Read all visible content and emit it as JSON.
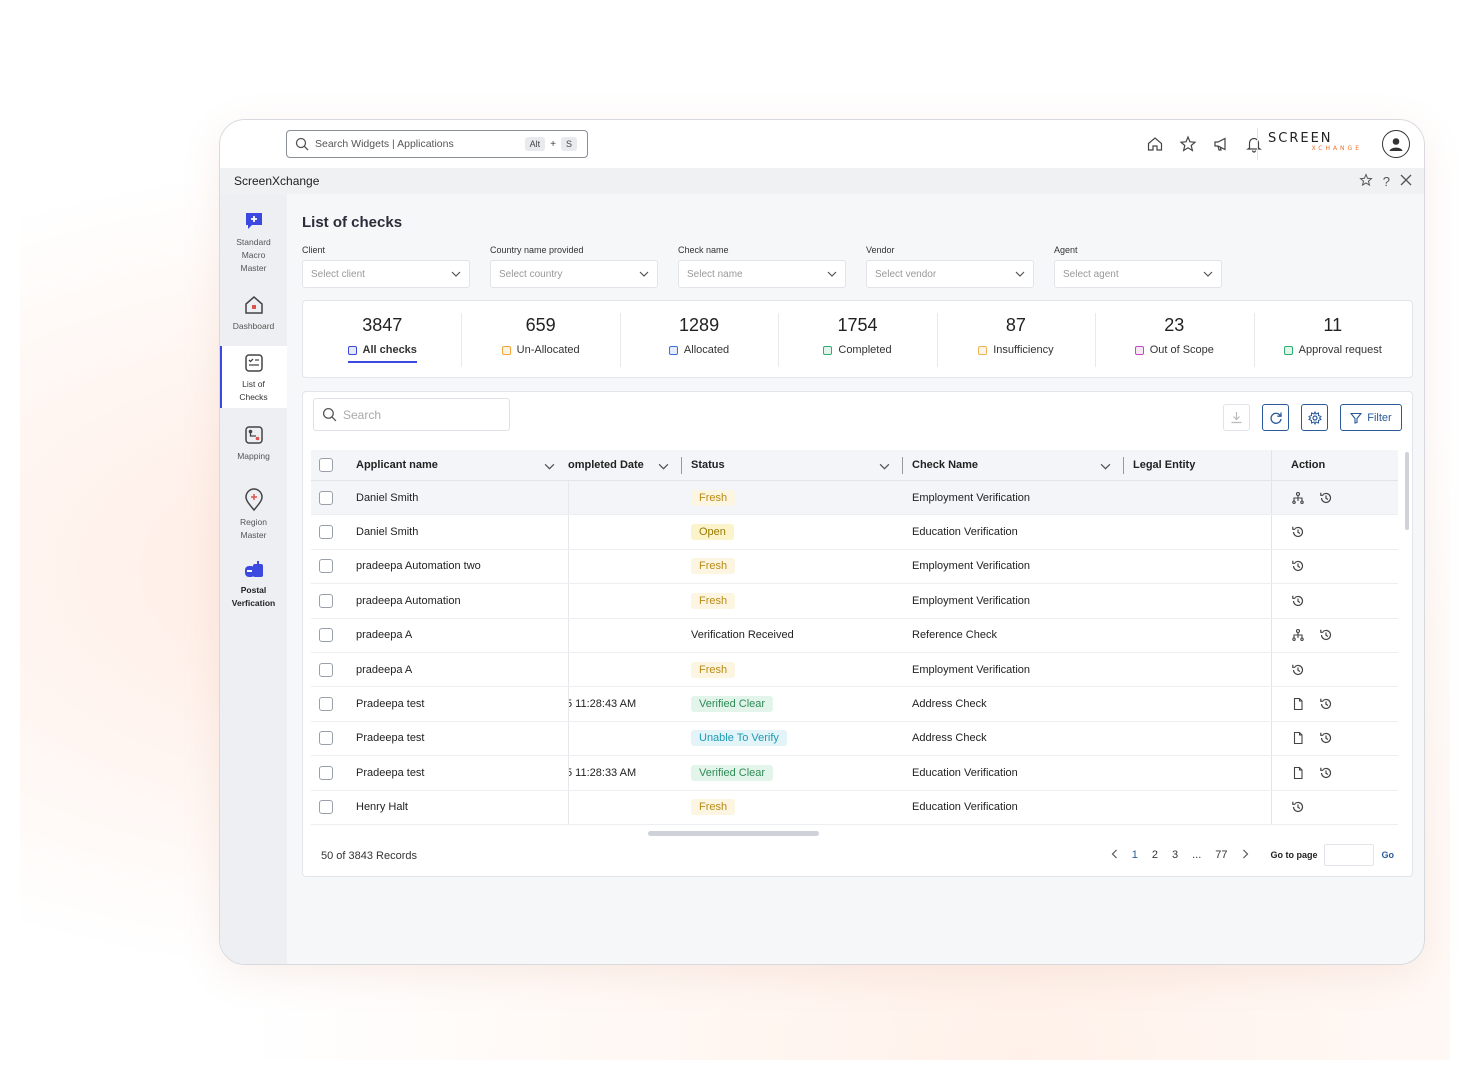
{
  "topbar": {
    "search_placeholder": "Search Widgets | Applications",
    "shortcut_key1": "Alt",
    "shortcut_plus": "+",
    "shortcut_key2": "S",
    "brand_name": "SCREEN",
    "brand_sub": "XCHANGE"
  },
  "appbar": {
    "title": "ScreenXchange"
  },
  "sidebar": {
    "items": [
      {
        "label": "Standard Macro Master",
        "icon": "plus-chat-icon"
      },
      {
        "label": "Dashboard",
        "icon": "home-icon"
      },
      {
        "label": "List of Checks",
        "icon": "checklist-icon"
      },
      {
        "label": "Mapping",
        "icon": "mapping-icon"
      },
      {
        "label": "Region Master",
        "icon": "location-pin-icon"
      },
      {
        "label": "Postal Verfication",
        "icon": "mailbox-icon"
      }
    ]
  },
  "page": {
    "title": "List of checks",
    "filters": [
      {
        "label": "Client",
        "placeholder": "Select client"
      },
      {
        "label": "Country name provided",
        "placeholder": "Select country"
      },
      {
        "label": "Check name",
        "placeholder": "Select name"
      },
      {
        "label": "Vendor",
        "placeholder": "Select vendor"
      },
      {
        "label": "Agent",
        "placeholder": "Select agent"
      }
    ],
    "stats": [
      {
        "count": "3847",
        "label": "All checks",
        "color": "#3b49e0"
      },
      {
        "count": "659",
        "label": "Un-Allocated",
        "color": "#f0a43a"
      },
      {
        "count": "1289",
        "label": "Allocated",
        "color": "#3b6fe0"
      },
      {
        "count": "1754",
        "label": "Completed",
        "color": "#2eae6e"
      },
      {
        "count": "87",
        "label": "Insufficiency",
        "color": "#f0b45a"
      },
      {
        "count": "23",
        "label": "Out of Scope",
        "color": "#c24ac2"
      },
      {
        "count": "11",
        "label": "Approval request",
        "color": "#2eae6e"
      }
    ]
  },
  "table": {
    "search_placeholder": "Search",
    "filter_label": "Filter",
    "columns": {
      "applicant": "Applicant name",
      "date": "ompleted Date",
      "status": "Status",
      "check": "Check Name",
      "legal": "Legal Entity",
      "action": "Action"
    },
    "rows": [
      {
        "name": "Daniel Smith",
        "date": "",
        "status": "Fresh",
        "status_type": "fresh",
        "check": "Employment Verification",
        "actions": [
          "hierarchy-icon",
          "history-icon"
        ]
      },
      {
        "name": "Daniel Smith",
        "date": "",
        "status": "Open",
        "status_type": "open",
        "check": "Education Verification",
        "actions": [
          "history-icon"
        ]
      },
      {
        "name": "pradeepa Automation two",
        "date": "",
        "status": "Fresh",
        "status_type": "fresh",
        "check": "Employment Verification",
        "actions": [
          "history-icon"
        ]
      },
      {
        "name": "pradeepa Automation",
        "date": "",
        "status": "Fresh",
        "status_type": "fresh",
        "check": "Employment Verification",
        "actions": [
          "history-icon"
        ]
      },
      {
        "name": "pradeepa A",
        "date": "",
        "status": "Verification Received",
        "status_type": "plain",
        "check": "Reference Check",
        "actions": [
          "hierarchy-icon",
          "history-icon"
        ]
      },
      {
        "name": "pradeepa A",
        "date": "",
        "status": "Fresh",
        "status_type": "fresh",
        "check": "Employment Verification",
        "actions": [
          "history-icon"
        ]
      },
      {
        "name": "Pradeepa test",
        "date": "5 11:28:43 AM",
        "status": "Verified Clear",
        "status_type": "clear",
        "check": "Address Check",
        "actions": [
          "document-icon",
          "history-icon"
        ]
      },
      {
        "name": "Pradeepa test",
        "date": "",
        "status": "Unable To Verify",
        "status_type": "utv",
        "check": "Address Check",
        "actions": [
          "document-icon",
          "history-icon"
        ]
      },
      {
        "name": "Pradeepa test",
        "date": "5 11:28:33 AM",
        "status": "Verified Clear",
        "status_type": "clear",
        "check": "Education Verification",
        "actions": [
          "document-icon",
          "history-icon"
        ]
      },
      {
        "name": "Henry Halt",
        "date": "",
        "status": "Fresh",
        "status_type": "fresh",
        "check": "Education Verification",
        "actions": [
          "history-icon"
        ]
      }
    ],
    "footer": {
      "records": "50 of 3843 Records",
      "pages": [
        "1",
        "2",
        "3",
        "...",
        "77"
      ],
      "goto_label": "Go to page",
      "go_label": "Go"
    }
  }
}
